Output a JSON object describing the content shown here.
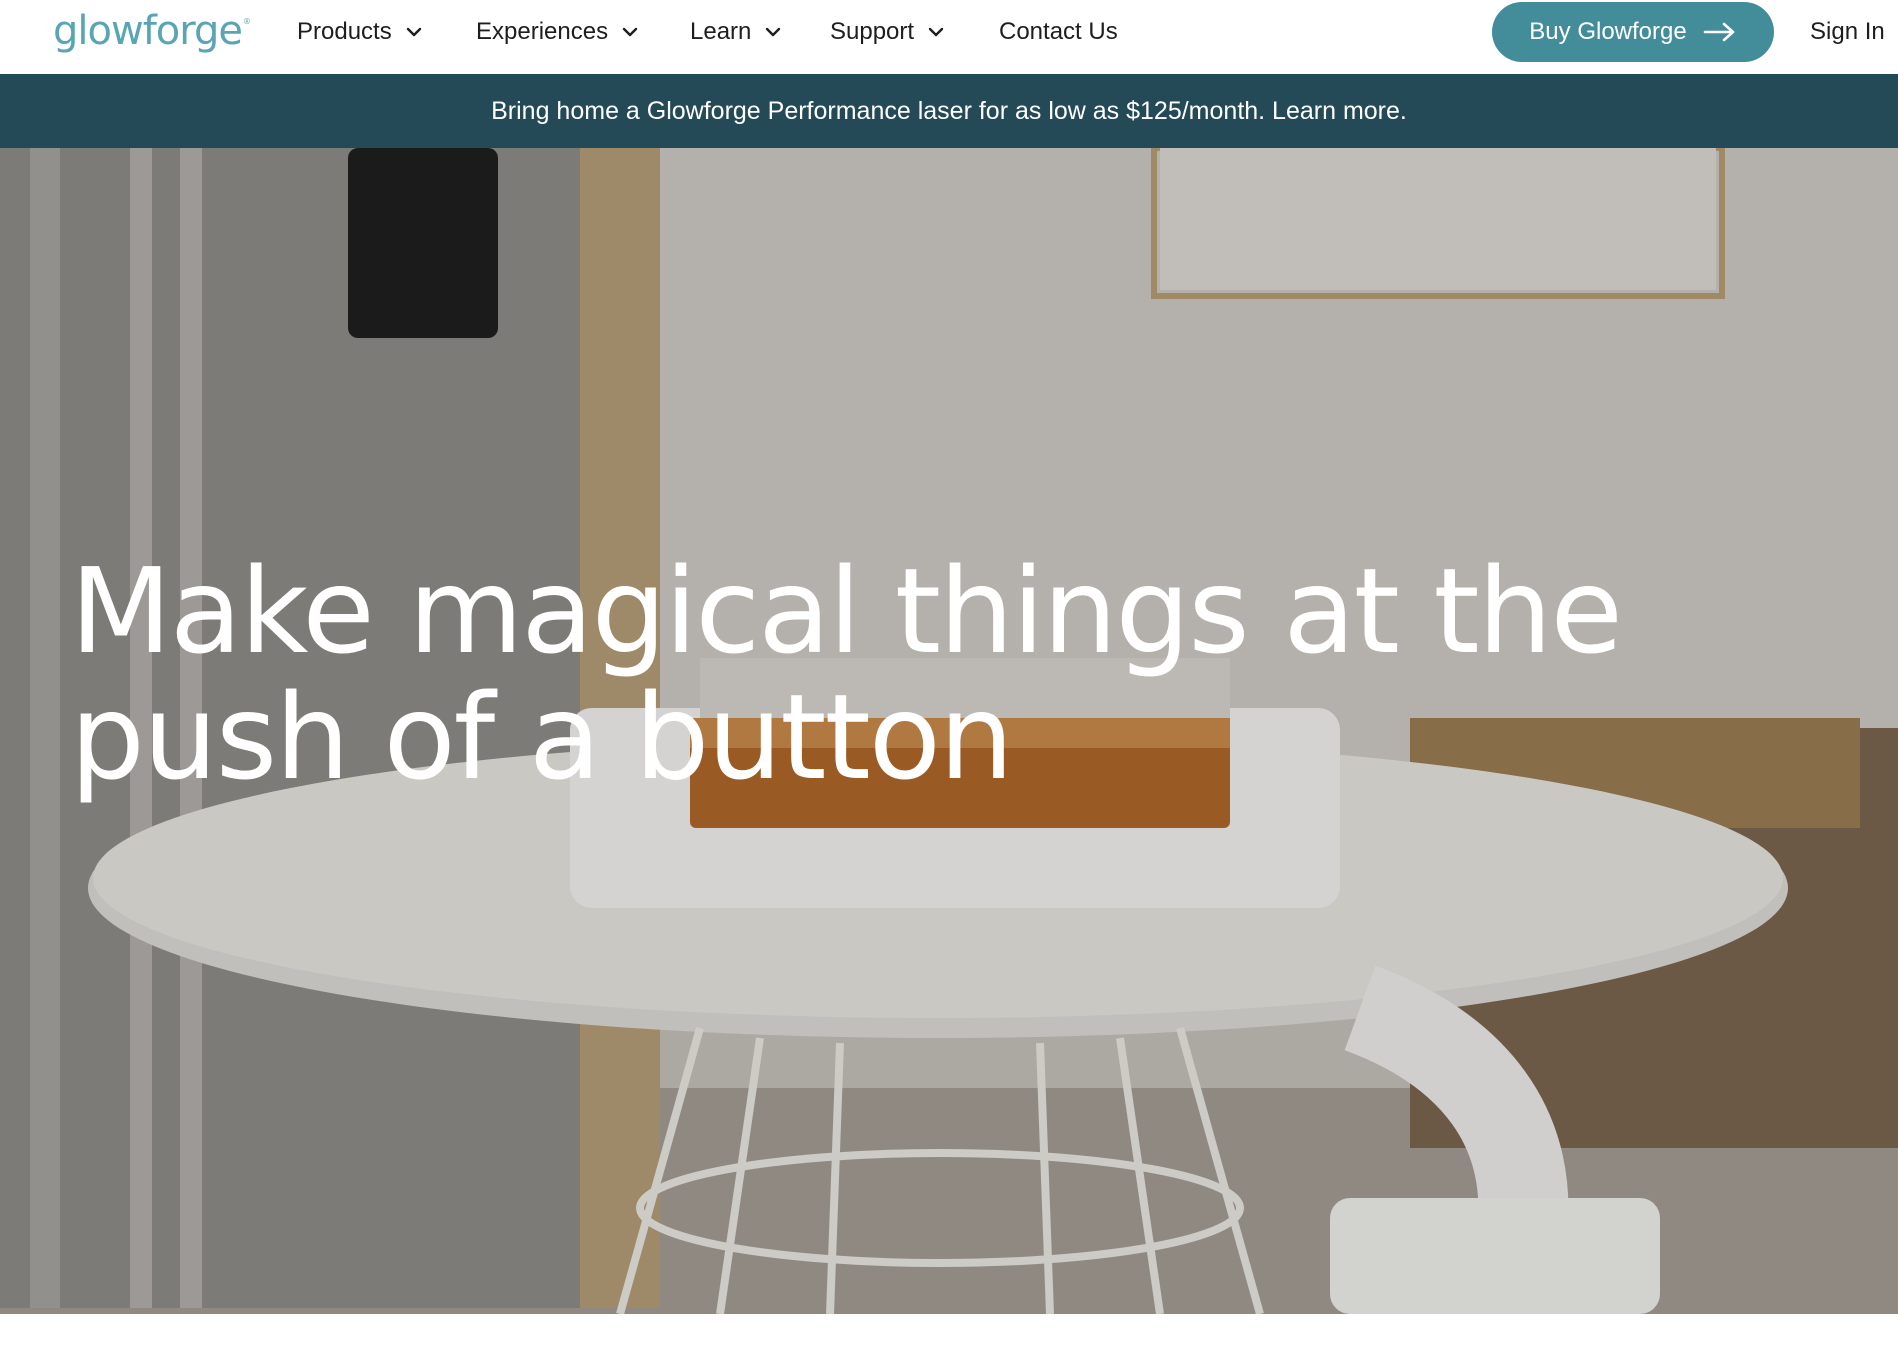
{
  "header": {
    "logo_text": "glowforge",
    "logo_mark": "®",
    "nav": [
      {
        "label": "Products",
        "has_dropdown": true,
        "icon": "chevron-down-icon"
      },
      {
        "label": "Experiences",
        "has_dropdown": true,
        "icon": "chevron-down-icon"
      },
      {
        "label": "Learn",
        "has_dropdown": true,
        "icon": "chevron-down-icon"
      },
      {
        "label": "Support",
        "has_dropdown": true,
        "icon": "chevron-down-icon"
      },
      {
        "label": "Contact Us",
        "has_dropdown": false
      }
    ],
    "buy_button": {
      "label": "Buy Glowforge",
      "icon": "arrow-right-icon"
    },
    "sign_in": "Sign In"
  },
  "promo_banner": {
    "text": "Bring home a Glowforge Performance laser for as low as $125/month. Learn more."
  },
  "hero": {
    "title": "Make magical things at the push of a button"
  },
  "colors": {
    "brand_teal": "#5aa5b4",
    "button_teal": "#438c9a",
    "banner_dark_teal": "#234a56",
    "text_dark": "#1e1e1e",
    "white": "#ffffff"
  }
}
